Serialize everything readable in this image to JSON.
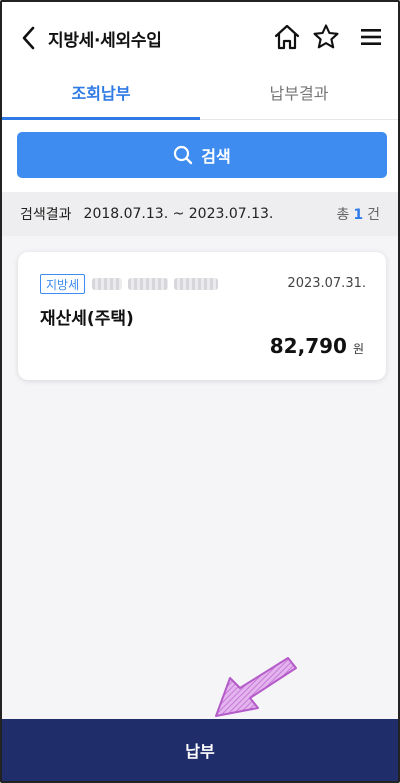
{
  "header": {
    "title": "지방세·세외수입",
    "back_icon": "chevron-left-icon",
    "home_icon": "home-icon",
    "star_icon": "star-icon",
    "menu_icon": "hamburger-menu-icon"
  },
  "tabs": [
    {
      "label": "조회납부",
      "active": true
    },
    {
      "label": "납부결과",
      "active": false
    }
  ],
  "search": {
    "button_label": "검색",
    "icon": "search-icon"
  },
  "results": {
    "label": "검색결과",
    "range": "2018.07.13. ~ 2023.07.13.",
    "count_prefix": "총",
    "count": "1",
    "count_suffix": "건"
  },
  "items": [
    {
      "badge": "지방세",
      "date": "2023.07.31.",
      "title": "재산세(주택)",
      "amount": "82,790",
      "unit": "원"
    }
  ],
  "footer": {
    "pay_label": "납부"
  },
  "colors": {
    "accent": "#2f7be6",
    "search_button": "#3f8cf0",
    "footer": "#1f2d6b",
    "annotation_arrow": "#c77ad8"
  }
}
